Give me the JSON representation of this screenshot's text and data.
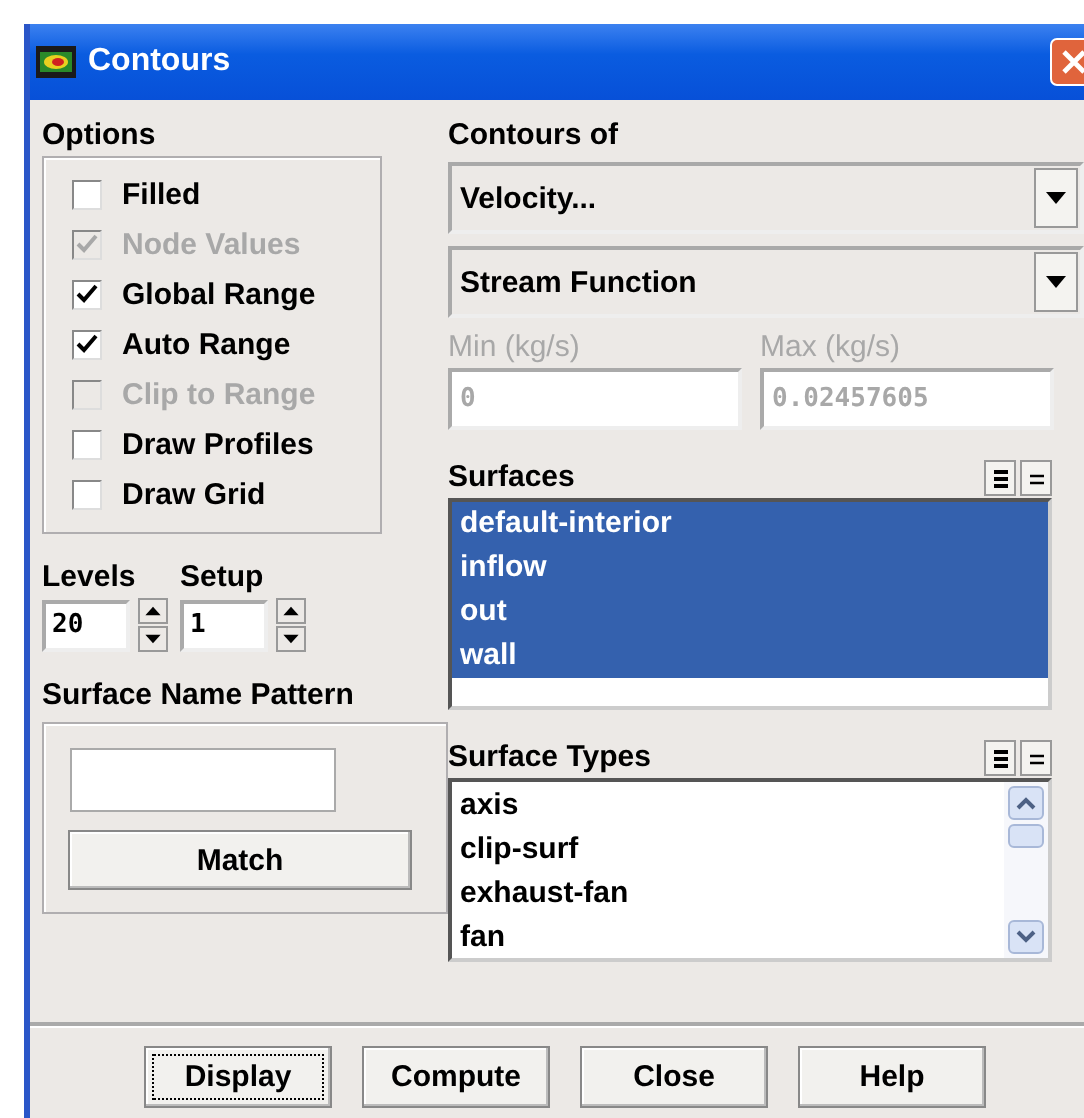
{
  "window": {
    "title": "Contours"
  },
  "options": {
    "label": "Options",
    "items": [
      {
        "label": "Filled",
        "checked": false,
        "disabled": false
      },
      {
        "label": "Node Values",
        "checked": true,
        "disabled": true
      },
      {
        "label": "Global Range",
        "checked": true,
        "disabled": false
      },
      {
        "label": "Auto Range",
        "checked": true,
        "disabled": false
      },
      {
        "label": "Clip to Range",
        "checked": false,
        "disabled": true
      },
      {
        "label": "Draw Profiles",
        "checked": false,
        "disabled": false
      },
      {
        "label": "Draw Grid",
        "checked": false,
        "disabled": false
      }
    ]
  },
  "spinners": [
    {
      "label": "Levels",
      "value": "20"
    },
    {
      "label": "Setup",
      "value": "1"
    }
  ],
  "surface_name_pattern": {
    "label": "Surface Name Pattern",
    "button": "Match"
  },
  "contours_of": {
    "label": "Contours of",
    "dropdowns": [
      {
        "value": "Velocity..."
      },
      {
        "value": "Stream Function"
      }
    ]
  },
  "range_fields": [
    {
      "label": "Min (kg/s)",
      "value": "0",
      "disabled": true
    },
    {
      "label": "Max (kg/s)",
      "value": "0.02457605",
      "disabled": true
    }
  ],
  "surfaces": {
    "label": "Surfaces",
    "items": [
      {
        "label": "default-interior",
        "selected": true
      },
      {
        "label": "inflow",
        "selected": true
      },
      {
        "label": "out",
        "selected": true
      },
      {
        "label": "wall",
        "selected": true
      }
    ]
  },
  "surface_types": {
    "label": "Surface Types",
    "items": [
      {
        "label": "axis",
        "selected": false
      },
      {
        "label": "clip-surf",
        "selected": false
      },
      {
        "label": "exhaust-fan",
        "selected": false
      },
      {
        "label": "fan",
        "selected": false
      }
    ]
  },
  "buttons": [
    {
      "label": "Display",
      "focused": true
    },
    {
      "label": "Compute",
      "focused": false
    },
    {
      "label": "Close",
      "focused": false
    },
    {
      "label": "Help",
      "focused": false
    }
  ]
}
